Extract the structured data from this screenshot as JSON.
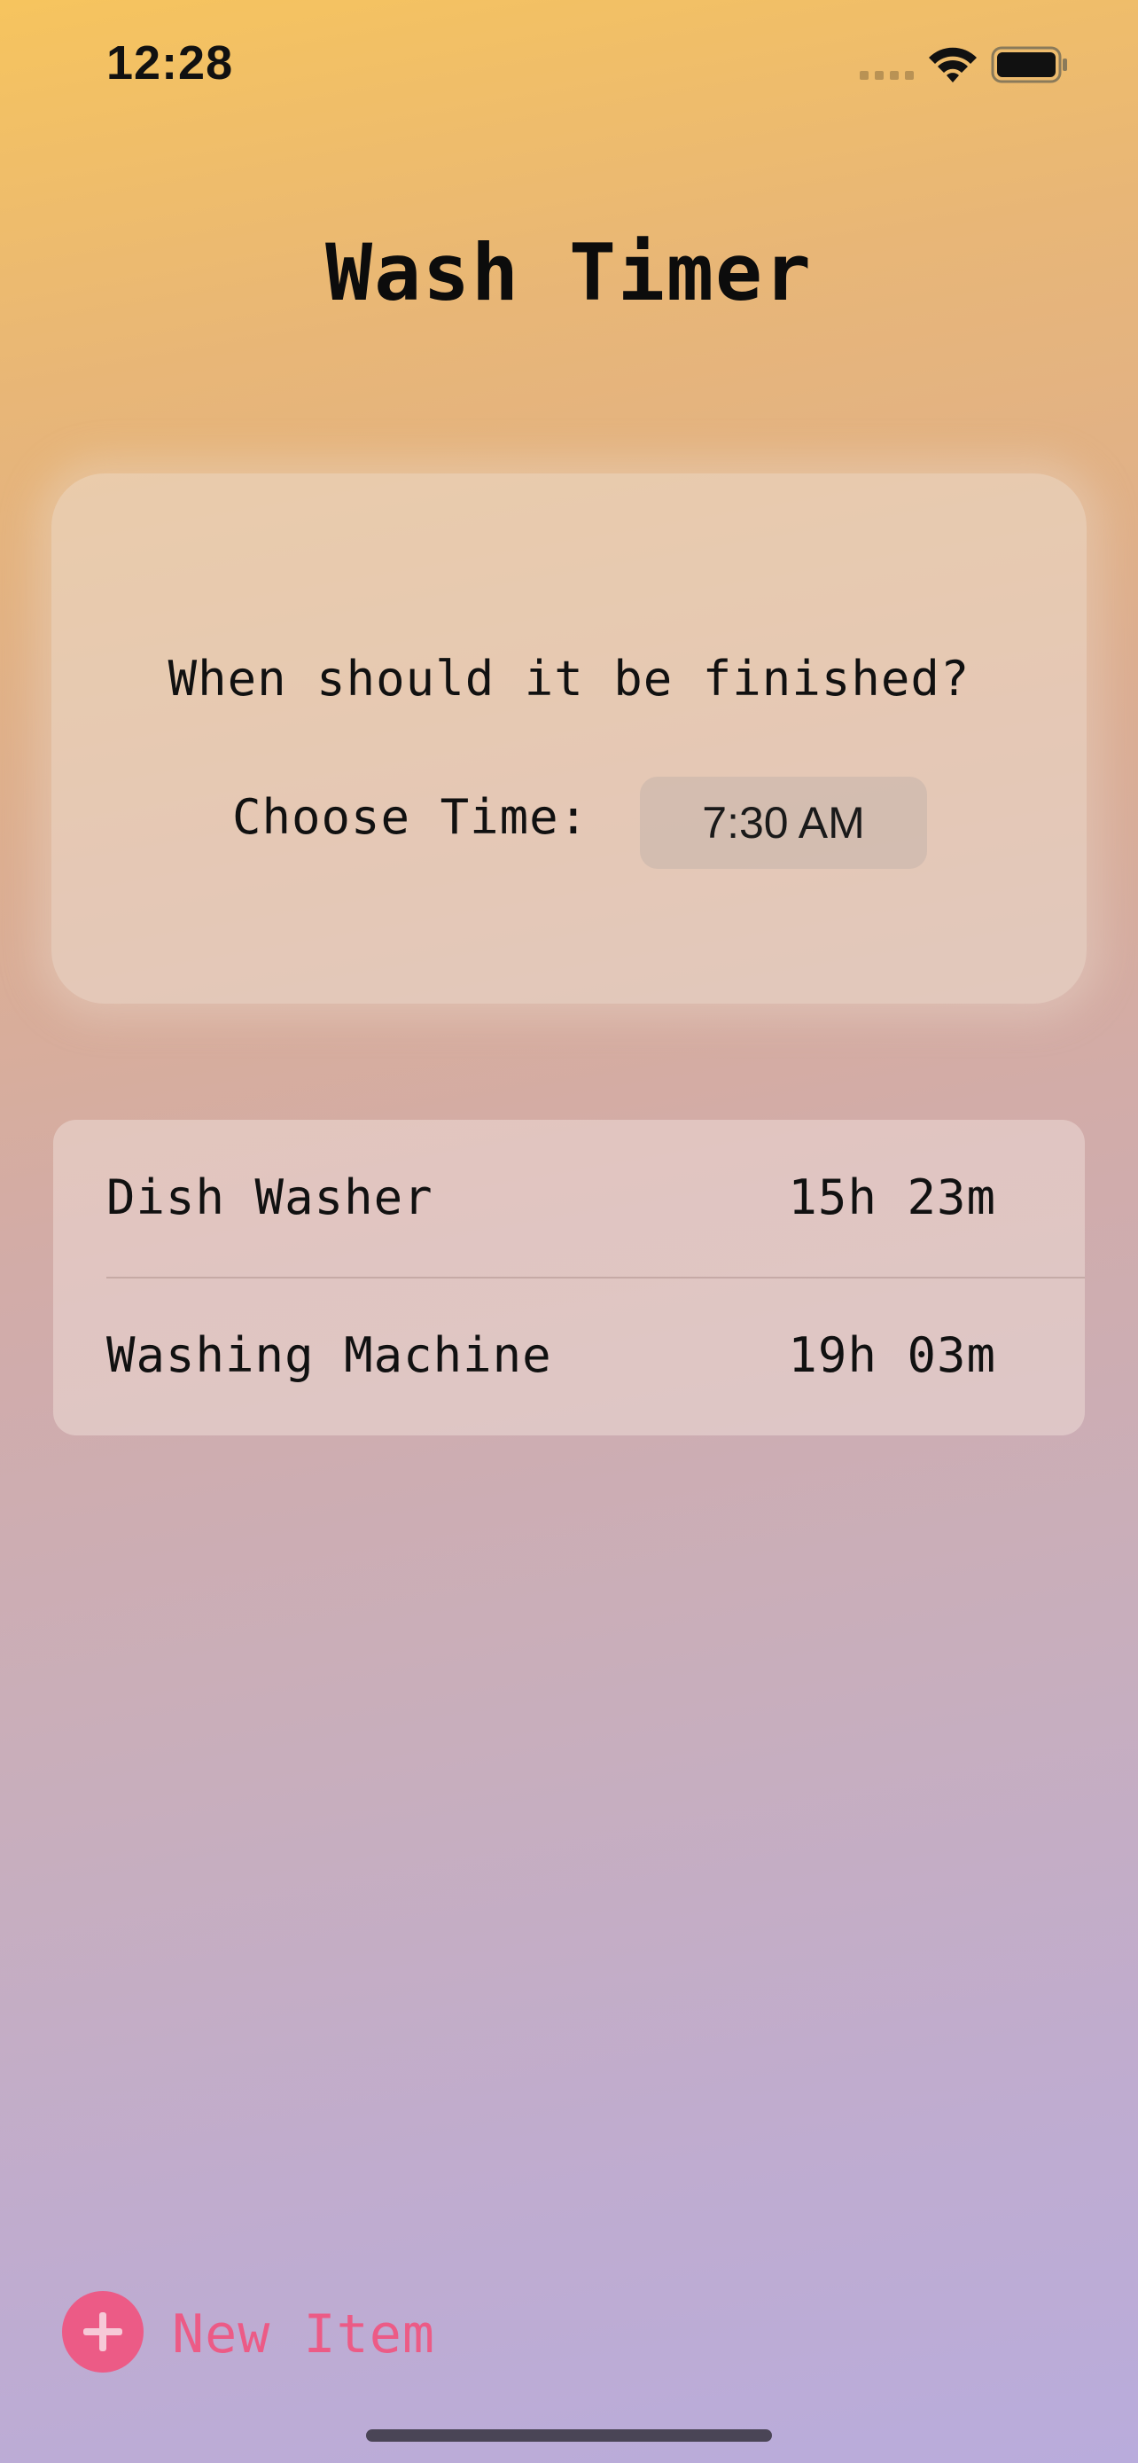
{
  "status_bar": {
    "time": "12:28"
  },
  "title": "Wash Timer",
  "time_card": {
    "question": "When should it be finished?",
    "choose_label": "Choose Time:",
    "selected_time": "7:30 AM"
  },
  "items": [
    {
      "name": "Dish Washer",
      "duration": "15h 23m"
    },
    {
      "name": "Washing Machine",
      "duration": "19h 03m"
    }
  ],
  "new_item": {
    "label": "New Item"
  },
  "colors": {
    "accent": "#ec5b86",
    "gradient_top": "#f6c45e",
    "gradient_bottom": "#b9acdc"
  },
  "icons": {
    "signal": "cellular-signal-icon",
    "wifi": "wifi-icon",
    "battery": "battery-icon",
    "add": "plus-circle-icon"
  }
}
